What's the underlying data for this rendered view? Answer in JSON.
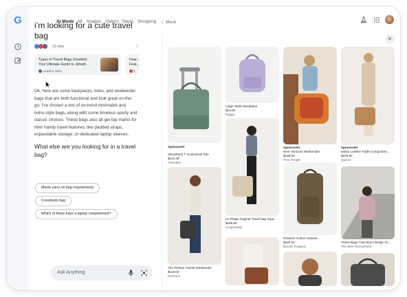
{
  "nav": {
    "tabs": [
      "AI Mode",
      "All",
      "Images",
      "Videos",
      "News",
      "Shopping",
      "⋮ More"
    ],
    "active_tab": "AI Mode"
  },
  "brand": {
    "logo_letter": "G",
    "logo_color": "#4285f4"
  },
  "conversation": {
    "query": "i’m looking for a cute travel bag",
    "sites_label": "10 sites",
    "sources": [
      {
        "title": "Types of Travel Bags Unveiled: Your Ultimate Guide to Jetsett...",
        "site": "Leather NEO"
      },
      {
        "title": "How... Feat...",
        "site": "1"
      }
    ],
    "answer": "Ok, here are some backpacks, totes, and weekender bags that are both functional and look great on-the-go. I've chosen a mix of on-trend minimalist and boho-style bags, along with some timeless sporty and classic choices. These bags also all get top marks for their handy travel features, like padded straps, expandable storage, or dedicated laptop sleeves.",
    "follow_question": "What else are you looking for in a travel bag?",
    "suggestions": [
      "Meets carry-on bag requirements",
      "Crossbody bag",
      "Which of these have a laptop compartment?"
    ],
    "input_placeholder": "Ask Anything"
  },
  "products": [
    {
      "name": "VersaPack™ UnderSeat Tote",
      "sponsored": "Sponsored",
      "price": "$144.49",
      "store": "Travelpro"
    },
    {
      "name": "Large Nylon Backpack",
      "price": "$10.00",
      "store": "Baggu"
    },
    {
      "name": "New Horizons Weekender",
      "sponsored": "Sponsored",
      "price": "$148.00",
      "store": "Free People"
    },
    {
      "name": "Italian Leather Triple Compartme...",
      "sponsored": "Sponsored",
      "price": "$229.50",
      "store": "Quince"
    },
    {
      "name": "Le Pliage Original Travel bag expa...",
      "price": "$285.00",
      "store": "Longchamp"
    },
    {
      "name": "Pickwick Cotton Canvas...",
      "price": "$220.00",
      "store": "Brooks England"
    },
    {
      "name": "Travel Bags That Won’t Weigh Yo...",
      "store": "The Bree Everywhere"
    },
    {
      "name": "The ReNew Transit Weekender",
      "price": "$119.00",
      "store": "Everlane"
    }
  ],
  "colors": {
    "accent": "#1a73e8",
    "rail_bg": "#f4f6fa",
    "chip_border": "#c4c7c5"
  }
}
